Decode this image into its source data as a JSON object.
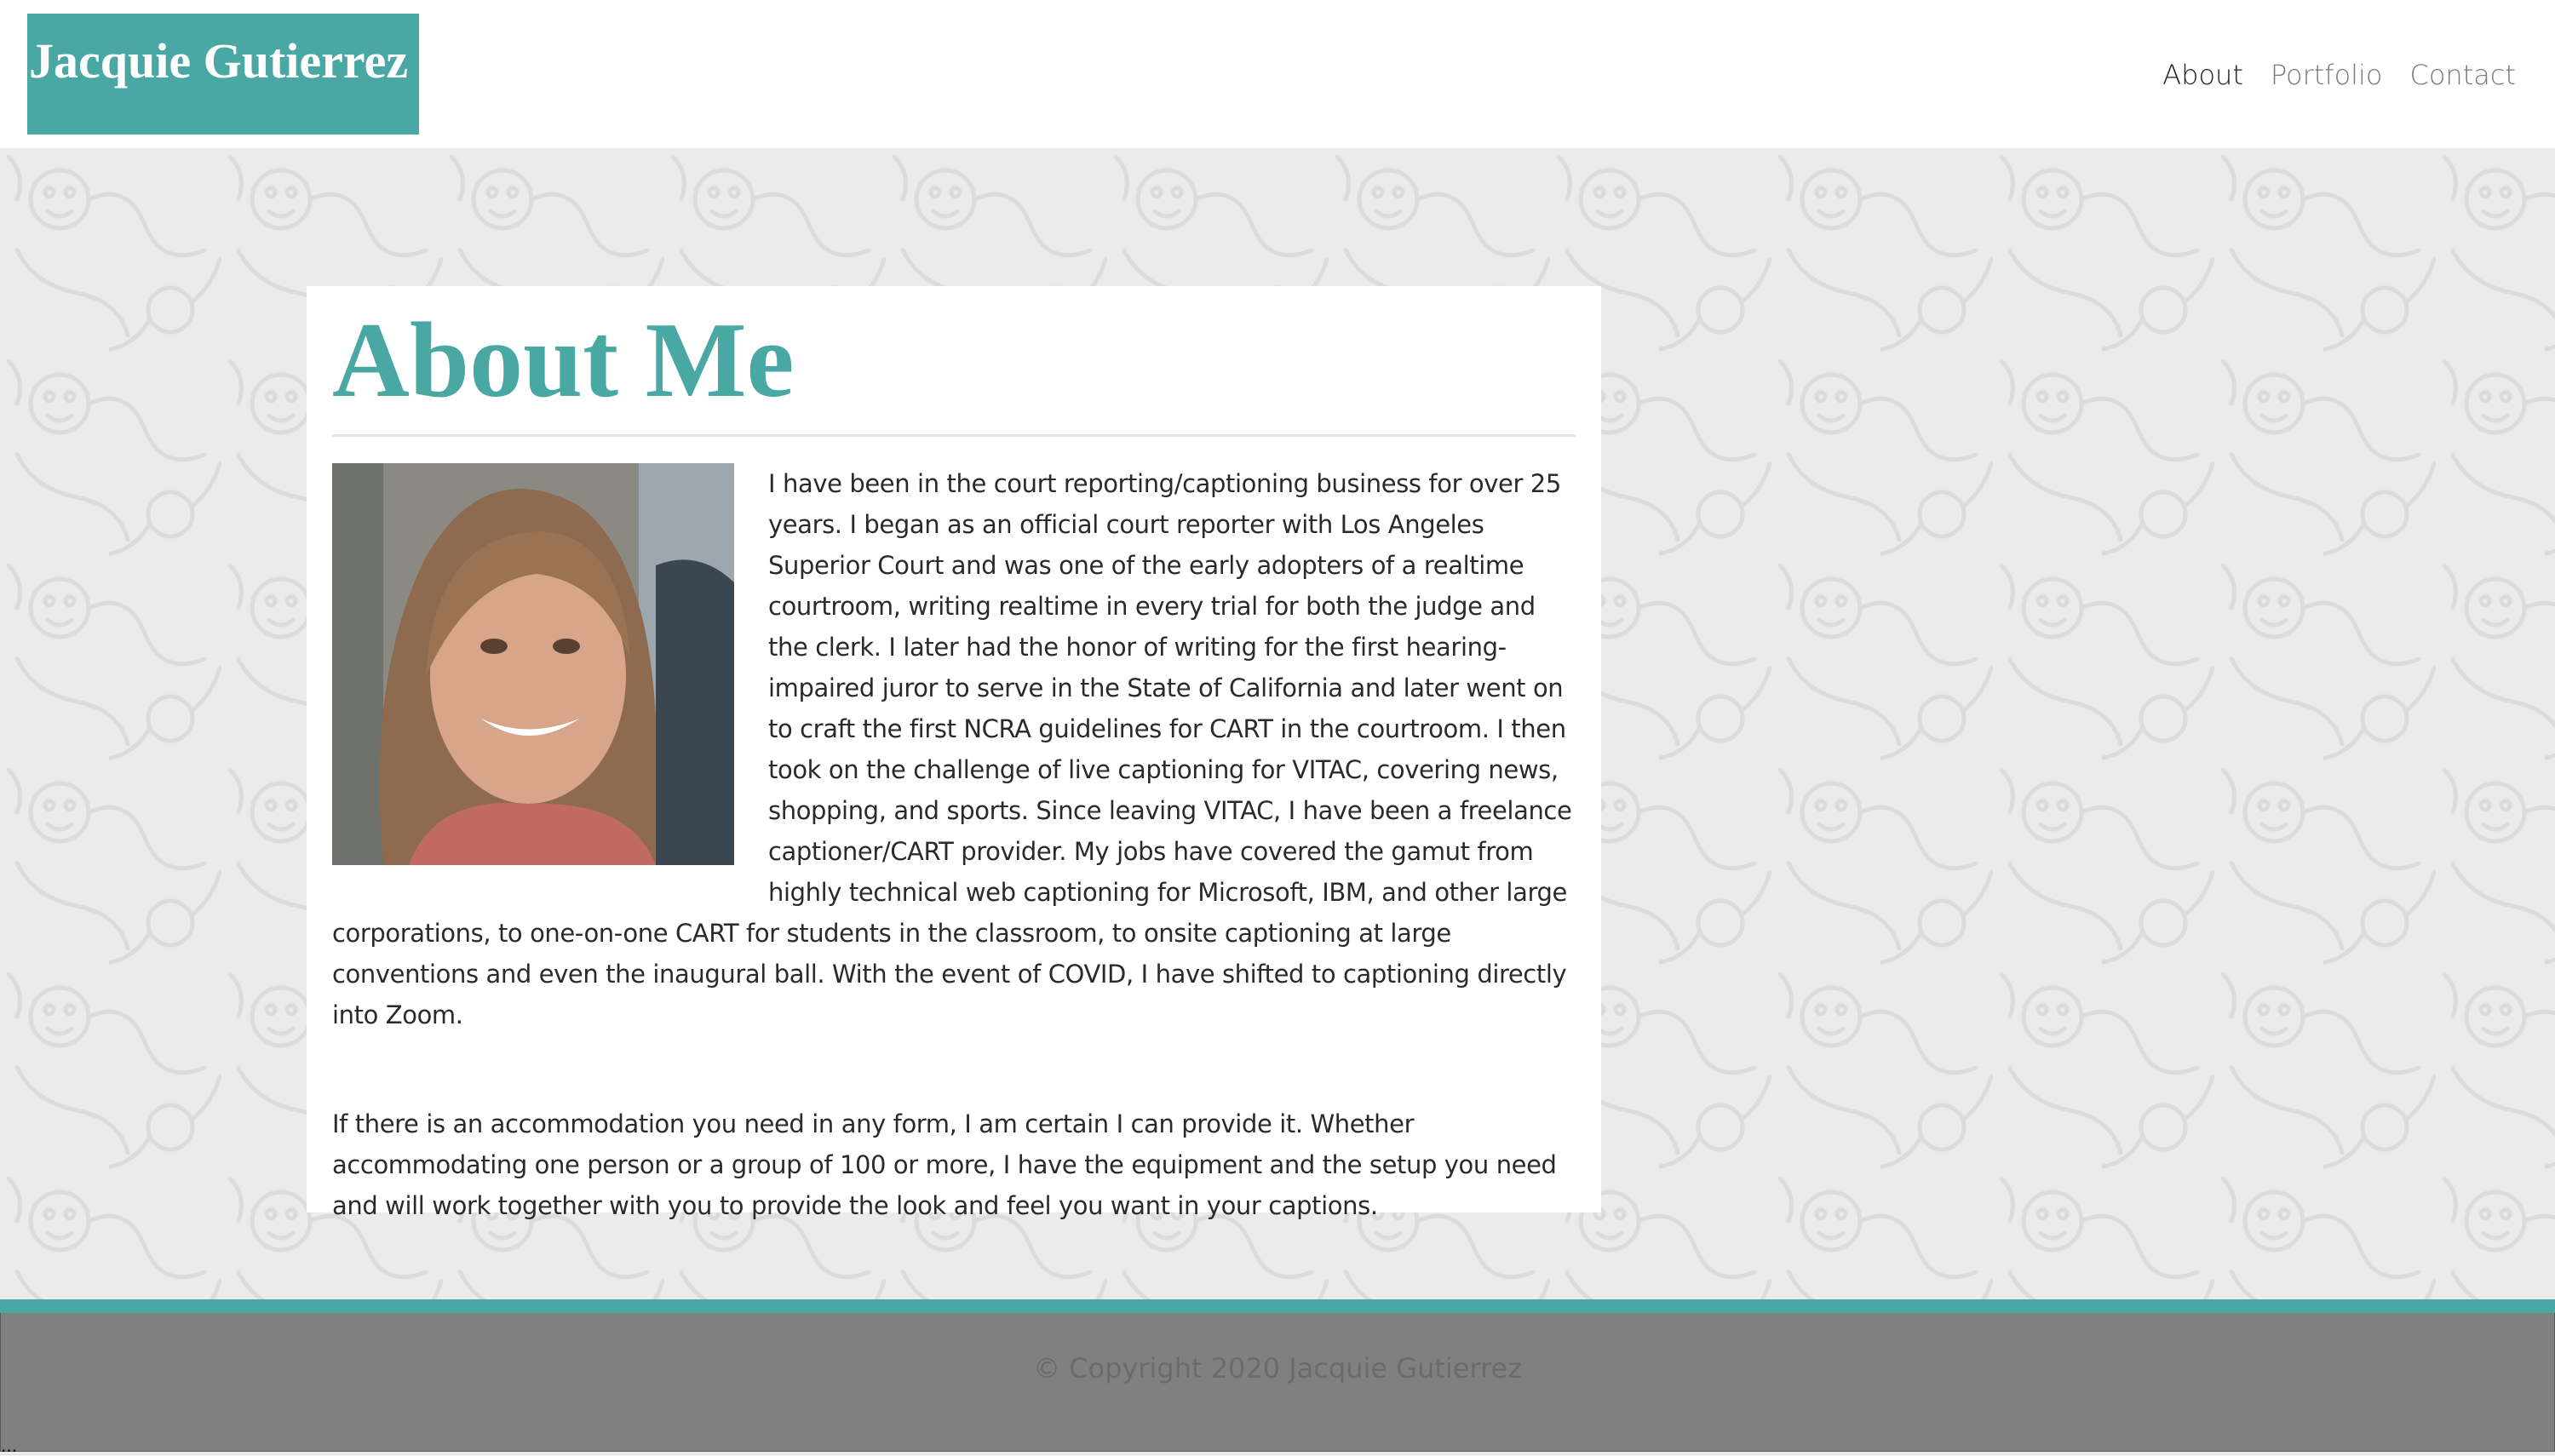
{
  "header": {
    "brand": "Jacquie Gutierrez",
    "nav": [
      {
        "label": "About",
        "active": true
      },
      {
        "label": "Portfolio",
        "active": false
      },
      {
        "label": "Contact",
        "active": false
      }
    ]
  },
  "about": {
    "title": "About Me",
    "paragraph_1": "I have been in the court reporting/captioning business for over 25 years. I began as an official court reporter with Los Angeles Superior Court and was one of the early adopters of a realtime courtroom, writing realtime in every trial for both the judge and the clerk. I later had the honor of writing for the first hearing-impaired juror to serve in the State of California and later went on to craft the first NCRA guidelines for CART in the courtroom. I then took on the challenge of live captioning for VITAC, covering news, shopping, and sports. Since leaving VITAC, I have been a freelance captioner/CART provider. My jobs have covered the gamut from highly technical web captioning for Microsoft, IBM, and other large corporations, to one-on-one CART for students in the classroom, to onsite captioning at large conventions and even the inaugural ball. With the event of COVID, I have shifted to captioning directly into Zoom.",
    "paragraph_2": "If there is an accommodation you need in any form, I am certain I can provide it. Whether accommodating one person or a group of 100 or more, I have the equipment and the setup you need and will work together with you to provide the look and feel you want in your captions."
  },
  "footer": {
    "copyright": "© Copyright 2020 Jacquie Gutierrez",
    "ellipsis": "..."
  },
  "colors": {
    "accent": "#4aa8a4",
    "footer": "#808080",
    "background": "#ebebeb"
  }
}
